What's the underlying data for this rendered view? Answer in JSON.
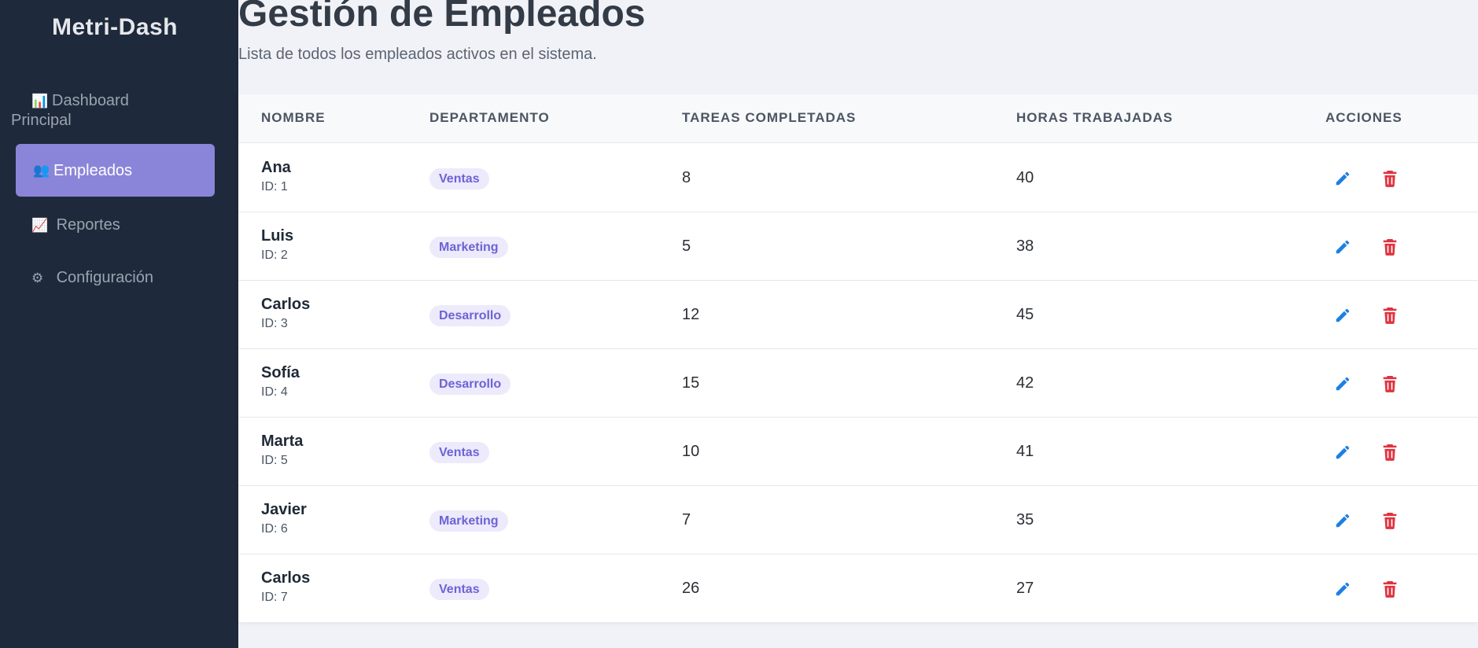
{
  "app": {
    "brand": "Metri-Dash"
  },
  "sidebar": {
    "items": [
      {
        "icon": "bar-chart-icon",
        "glyph": "📊",
        "label": "Dashboard Principal",
        "active": false
      },
      {
        "icon": "people-icon",
        "glyph": "👥",
        "label": "Empleados",
        "active": true
      },
      {
        "icon": "trend-chart-icon",
        "glyph": "📈",
        "label": "Reportes",
        "active": false
      },
      {
        "icon": "gear-icon",
        "glyph": "⚙",
        "label": "Configuración",
        "active": false
      }
    ]
  },
  "page": {
    "title": "Gestión de Empleados",
    "subtitle": "Lista de todos los empleados activos en el sistema."
  },
  "table": {
    "columns": [
      "Nombre",
      "Departamento",
      "Tareas Completadas",
      "Horas Trabajadas",
      "Acciones"
    ],
    "rows": [
      {
        "name": "Ana",
        "id_label": "ID: 1",
        "department": "Ventas",
        "tasks": "8",
        "hours": "40"
      },
      {
        "name": "Luis",
        "id_label": "ID: 2",
        "department": "Marketing",
        "tasks": "5",
        "hours": "38"
      },
      {
        "name": "Carlos",
        "id_label": "ID: 3",
        "department": "Desarrollo",
        "tasks": "12",
        "hours": "45"
      },
      {
        "name": "Sofía",
        "id_label": "ID: 4",
        "department": "Desarrollo",
        "tasks": "15",
        "hours": "42"
      },
      {
        "name": "Marta",
        "id_label": "ID: 5",
        "department": "Ventas",
        "tasks": "10",
        "hours": "41"
      },
      {
        "name": "Javier",
        "id_label": "ID: 6",
        "department": "Marketing",
        "tasks": "7",
        "hours": "35"
      },
      {
        "name": "Carlos",
        "id_label": "ID: 7",
        "department": "Ventas",
        "tasks": "26",
        "hours": "27"
      }
    ],
    "actions": {
      "edit_icon": "pencil-icon",
      "delete_icon": "trash-icon"
    }
  },
  "colors": {
    "sidebar_bg": "#1e293b",
    "active_item": "#8b85d9",
    "badge_bg": "#eceafb",
    "badge_text": "#6d63d6",
    "edit": "#1d7fe3",
    "delete": "#e0323f"
  }
}
